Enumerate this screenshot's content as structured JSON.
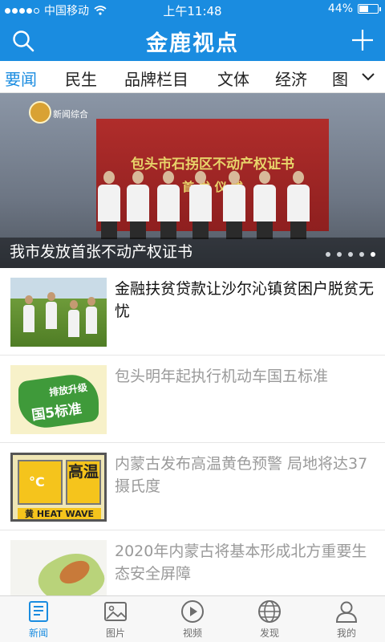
{
  "status_bar": {
    "carrier": "中国移动",
    "time": "上午11:48",
    "battery": "44%",
    "battery_level": 0.44
  },
  "navbar": {
    "title": "金鹿视点",
    "search_icon": "search-icon",
    "add_icon": "plus-icon"
  },
  "tabs": [
    {
      "label": "要闻",
      "active": true
    },
    {
      "label": "民生",
      "active": false
    },
    {
      "label": "品牌栏目",
      "active": false
    },
    {
      "label": "文体",
      "active": false
    },
    {
      "label": "经济",
      "active": false
    },
    {
      "label": "图",
      "active": false
    }
  ],
  "hero": {
    "caption": "我市发放首张不动产权证书",
    "banner_line1": "包头市石拐区不动产权证书",
    "banner_line2": "首 发 仪 式",
    "channel_logo_text": "新闻综合",
    "page_count": 5,
    "current_page": 5
  },
  "news": [
    {
      "title": "金融扶贫贷款让沙尔沁镇贫困户脱贫无忧",
      "read": false,
      "thumb": "farm"
    },
    {
      "title": "包头明年起执行机动车国五标准",
      "read": true,
      "thumb": "emission"
    },
    {
      "title": "内蒙古发布高温黄色预警 局地将达37摄氏度",
      "read": true,
      "thumb": "heat"
    },
    {
      "title": "2020年内蒙古将基本形成北方重要生态安全屏障",
      "read": true,
      "thumb": "map"
    }
  ],
  "thumb_text": {
    "emission_top": "排放升级",
    "emission_main": "国5标准",
    "heat_symbol": "°C",
    "heat_right": "高温",
    "heat_left_badge": "黄",
    "heat_bottom": "HEAT WAVE"
  },
  "bottom_tabs": [
    {
      "label": "新闻",
      "icon": "news-icon",
      "active": true
    },
    {
      "label": "图片",
      "icon": "image-icon",
      "active": false
    },
    {
      "label": "视频",
      "icon": "video-play-icon",
      "active": false
    },
    {
      "label": "发现",
      "icon": "globe-icon",
      "active": false
    },
    {
      "label": "我的",
      "icon": "user-icon",
      "active": false
    }
  ],
  "colors": {
    "brand": "#1a8ce0",
    "read_text": "#9a9a9a"
  }
}
